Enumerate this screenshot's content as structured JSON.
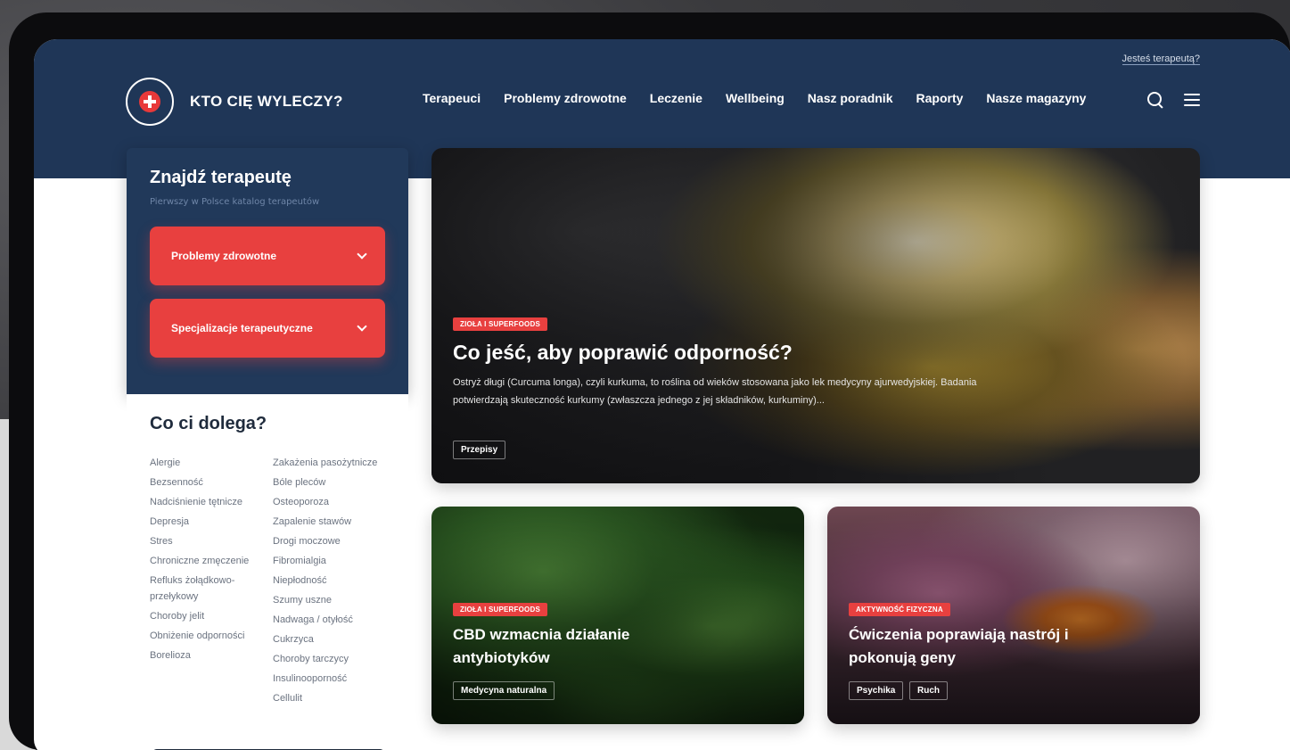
{
  "header": {
    "therapist_link": "Jesteś terapeutą?",
    "logo_text": "KTO CIĘ WYLECZY?",
    "nav": [
      "Terapeuci",
      "Problemy zdrowotne",
      "Leczenie",
      "Wellbeing",
      "Nasz poradnik",
      "Raporty",
      "Nasze magazyny"
    ],
    "icons": [
      "search-icon",
      "menu-icon"
    ]
  },
  "finder": {
    "title": "Znajdź terapeutę",
    "subtitle": "Pierwszy w Polsce katalog terapeutów",
    "dropdowns": [
      "Problemy zdrowotne",
      "Specjalizacje terapeutyczne"
    ]
  },
  "ailments": {
    "title": "Co ci dolega?",
    "col1": [
      "Alergie",
      "Bezsenność",
      "Nadciśnienie tętnicze",
      "Depresja",
      "Stres",
      "Chroniczne zmęczenie",
      "Refluks żołądkowo-przełykowy",
      "Choroby jelit",
      "Obniżenie odporności",
      "Borelioza"
    ],
    "col2": [
      "Zakażenia pasożytnicze",
      "Bóle pleców",
      "Osteoporoza",
      "Zapalenie stawów",
      "Drogi moczowe",
      "Fibromialgia",
      "Niepłodność",
      "Szumy uszne",
      "Nadwaga / otyłość",
      "Cukrzyca",
      "Choroby tarczycy",
      "Insulinooporność",
      "Cellulit"
    ]
  },
  "hero": {
    "badge": "ZIOŁA I SUPERFOODS",
    "title": "Co jeść, aby poprawić odporność?",
    "excerpt": "Ostryż długi (Curcuma longa), czyli kurkuma, to roślina od wieków stosowana jako lek medycyny ajurwedyjskiej. Badania potwierdzają skuteczność kurkumy (zwłaszcza jednego z jej składników, kurkuminy)...",
    "tag": "Przepisy"
  },
  "card_cbd": {
    "badge": "ZIOŁA I SUPERFOODS",
    "title_line1": "CBD wzmacnia działanie",
    "title_line2": "antybiotyków",
    "tag": "Medycyna naturalna"
  },
  "card_yoga": {
    "badge": "AKTYWNOŚĆ FIZYCZNA",
    "title_line1": "Ćwiczenia poprawiają nastrój i",
    "title_line2": "pokonują geny",
    "tags": [
      "Psychika",
      "Ruch"
    ]
  },
  "colors": {
    "navy": "#1f3657",
    "accent_red": "#e8403f",
    "text_dark": "#1f2b3c"
  }
}
